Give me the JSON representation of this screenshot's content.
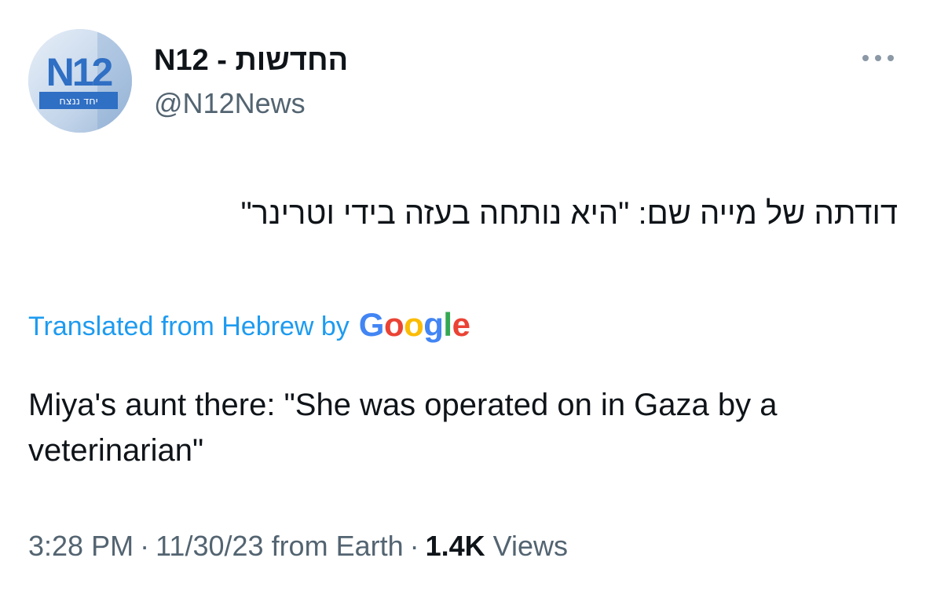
{
  "author": {
    "avatar_brand": "N12",
    "avatar_tagline": "יחד ננצח",
    "display_name": "N12 - החדשות",
    "handle": "@N12News"
  },
  "tweet": {
    "text_original": "דודתה של מייה שם: \"היא נותחה בעזה בידי וטרינר\"",
    "translated_from": "Translated from Hebrew by",
    "translation_provider": "Google",
    "text_translated": "Miya's aunt there: \"She was operated on in Gaza by a veterinarian\""
  },
  "meta": {
    "time": "3:28 PM",
    "separator": "·",
    "date": "11/30/23",
    "source": "from Earth",
    "views_count": "1.4K",
    "views_label": "Views"
  },
  "icons": {
    "more": "more-horizontal-icon"
  },
  "colors": {
    "link_blue": "#1d9bf0",
    "secondary_text": "#536471",
    "primary_text": "#0f1419",
    "google_blue": "#4285f4",
    "google_red": "#ea4335",
    "google_yellow": "#fbbc05",
    "google_green": "#34a853"
  }
}
